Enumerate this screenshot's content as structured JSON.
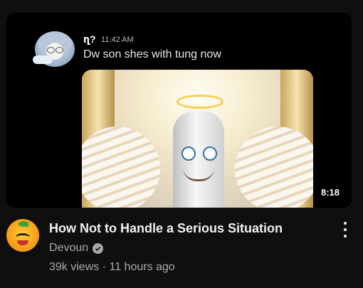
{
  "thumbnail": {
    "message": {
      "username": "ղ?",
      "time": "11:42 AM",
      "text": "Dw son shes with tung now"
    },
    "duration": "8:18"
  },
  "video": {
    "title": "How Not to Handle a Serious Situation",
    "channel": "Devoun",
    "channel_verified": true,
    "views": "39k views",
    "separator": "·",
    "age": "11 hours ago"
  },
  "icons": {
    "verified": "verified-check-icon",
    "more": "more-vert-icon"
  },
  "colors": {
    "background": "#0f0f0f",
    "primary_text": "#f1f1f1",
    "secondary_text": "#aaaaaa"
  }
}
